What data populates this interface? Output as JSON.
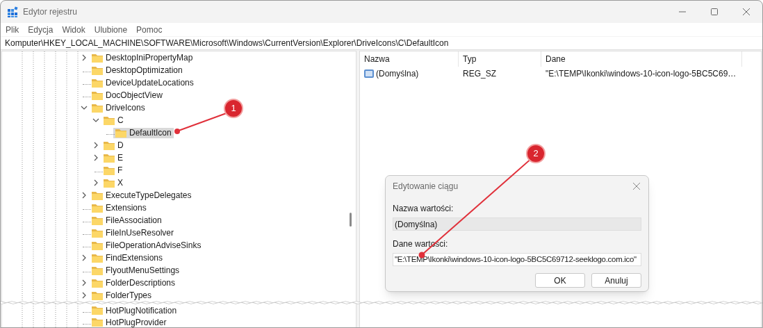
{
  "window": {
    "title": "Edytor rejestru"
  },
  "menu": [
    "Plik",
    "Edycja",
    "Widok",
    "Ulubione",
    "Pomoc"
  ],
  "address": "Komputer\\HKEY_LOCAL_MACHINE\\SOFTWARE\\Microsoft\\Windows\\CurrentVersion\\Explorer\\DriveIcons\\C\\DefaultIcon",
  "tree": {
    "items": [
      {
        "label": "DesktopIniPropertyMap",
        "kind": "collapsed",
        "selected": false
      },
      {
        "label": "DesktopOptimization",
        "kind": "leaf",
        "selected": false
      },
      {
        "label": "DeviceUpdateLocations",
        "kind": "leaf",
        "selected": false
      },
      {
        "label": "DocObjectView",
        "kind": "leaf",
        "selected": false
      },
      {
        "label": "DriveIcons",
        "kind": "expanded",
        "selected": false,
        "children": [
          {
            "label": "C",
            "kind": "expanded",
            "selected": false,
            "children": [
              {
                "label": "DefaultIcon",
                "kind": "leaf",
                "selected": true
              }
            ]
          },
          {
            "label": "D",
            "kind": "collapsed",
            "selected": false
          },
          {
            "label": "E",
            "kind": "collapsed",
            "selected": false
          },
          {
            "label": "F",
            "kind": "leaf",
            "selected": false
          },
          {
            "label": "X",
            "kind": "collapsed",
            "selected": false
          }
        ]
      },
      {
        "label": "ExecuteTypeDelegates",
        "kind": "collapsed",
        "selected": false
      },
      {
        "label": "Extensions",
        "kind": "leaf",
        "selected": false
      },
      {
        "label": "FileAssociation",
        "kind": "leaf",
        "selected": false
      },
      {
        "label": "FileInUseResolver",
        "kind": "leaf",
        "selected": false
      },
      {
        "label": "FileOperationAdviseSinks",
        "kind": "leaf",
        "selected": false
      },
      {
        "label": "FindExtensions",
        "kind": "collapsed",
        "selected": false
      },
      {
        "label": "FlyoutMenuSettings",
        "kind": "leaf",
        "selected": false
      },
      {
        "label": "FolderDescriptions",
        "kind": "collapsed",
        "selected": false
      },
      {
        "label": "FolderTypes",
        "kind": "collapsed",
        "selected": false
      }
    ],
    "continued_items": [
      {
        "label": "HotPlugNotification",
        "kind": "leaf",
        "selected": false
      },
      {
        "label": "HotPlugProvider",
        "kind": "leaf",
        "selected": false
      }
    ]
  },
  "values": {
    "columns": [
      "Nazwa",
      "Typ",
      "Dane"
    ],
    "rows": [
      {
        "name": "(Domyślna)",
        "type": "REG_SZ",
        "data": "\"E:\\TEMP\\Ikonki\\windows-10-icon-logo-5BC5C69…"
      }
    ]
  },
  "dialog": {
    "title": "Edytowanie ciągu",
    "name_label": "Nazwa wartości:",
    "name_value": "(Domyślna)",
    "data_label": "Dane wartości:",
    "data_value": "\"E:\\TEMP\\Ikonki\\windows-10-icon-logo-5BC5C69712-seeklogo.com.ico\"",
    "buttons": [
      "OK",
      "Anuluj"
    ]
  },
  "annotations": [
    {
      "number": "1"
    },
    {
      "number": "2"
    }
  ]
}
